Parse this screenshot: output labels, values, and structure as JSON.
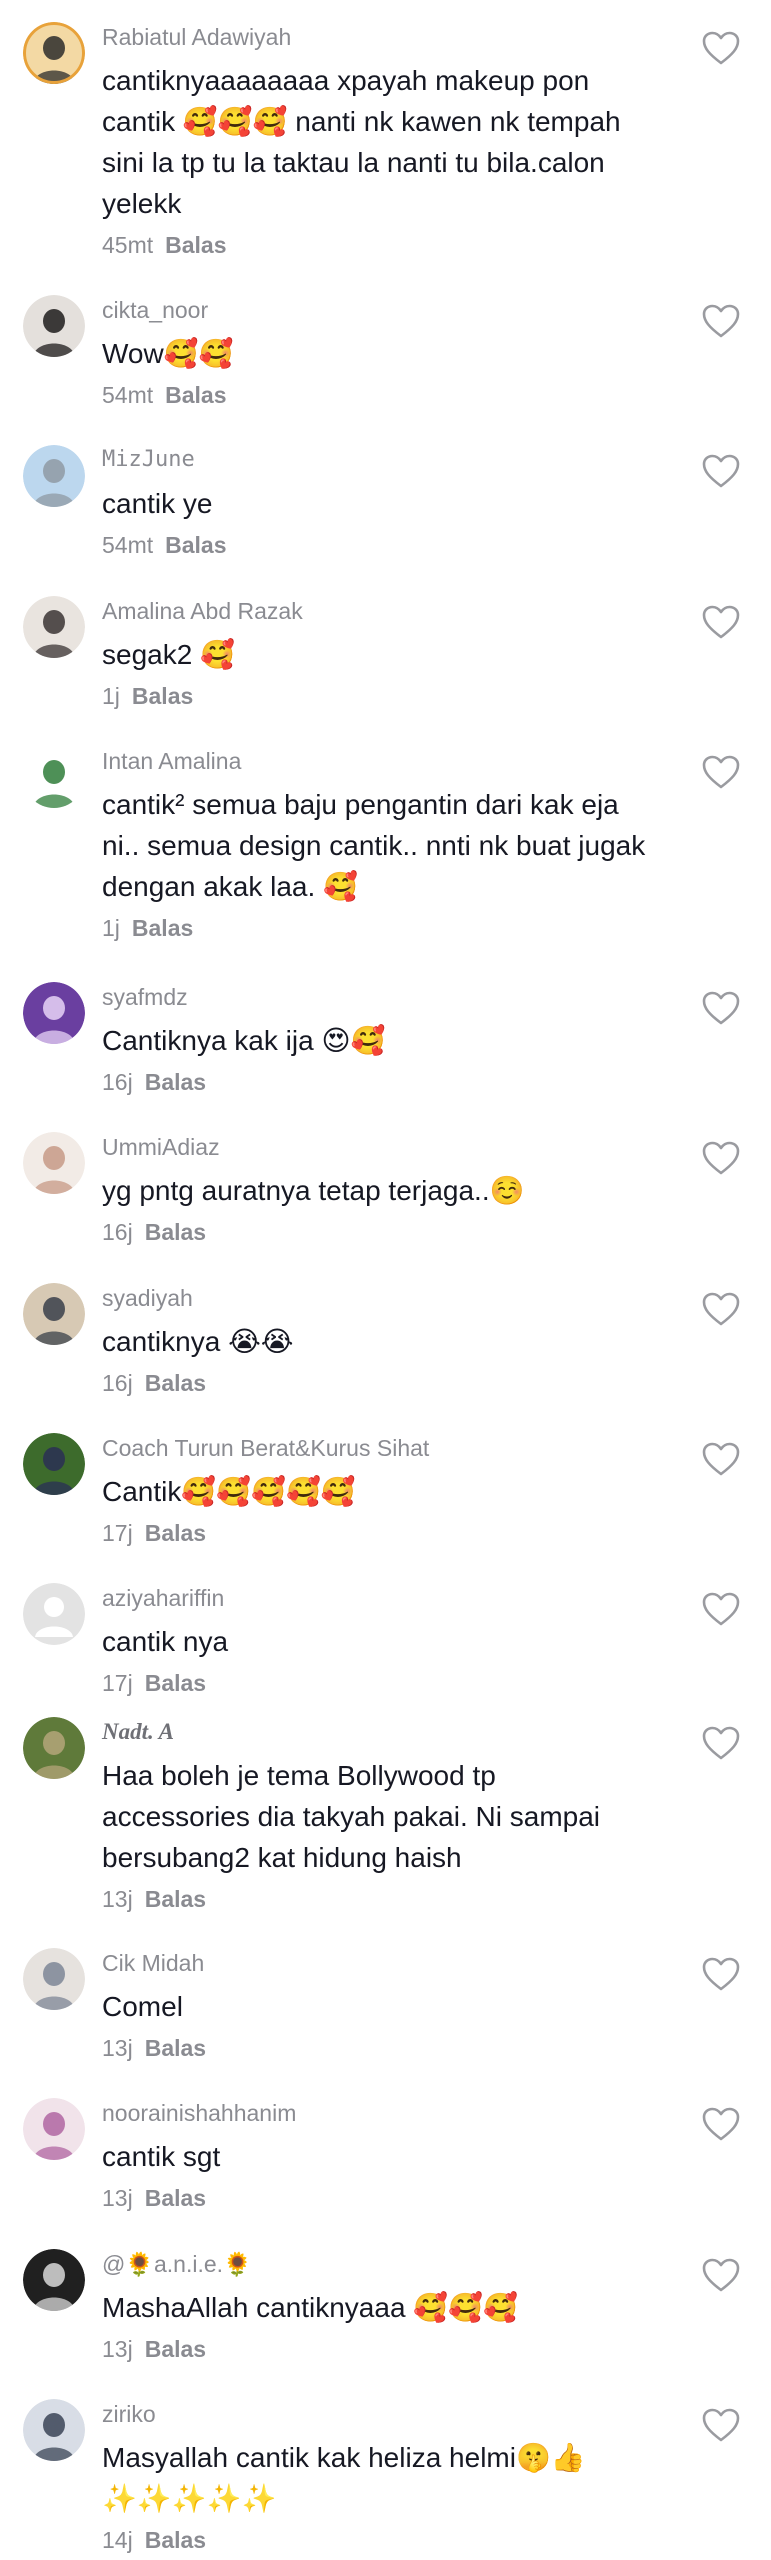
{
  "ui": {
    "reply_label": "Balas"
  },
  "comments": [
    {
      "username": "Rabiatul Adawiyah",
      "lines": [
        "cantiknyaaaaaaaa xpayah makeup pon",
        "cantik 🥰🥰🥰 nanti nk kawen nk tempah",
        "sini la tp tu la taktau la nanti tu bila.calon",
        "yelekk"
      ],
      "time": "45mt"
    },
    {
      "username": "cikta_noor",
      "lines": [
        "Wow🥰🥰"
      ],
      "time": "54mt"
    },
    {
      "username": "MizJune",
      "lines": [
        "cantik ye"
      ],
      "time": "54mt"
    },
    {
      "username": "Amalina Abd Razak",
      "lines": [
        "segak2 🥰"
      ],
      "time": "1j"
    },
    {
      "username": "Intan Amalina",
      "lines": [
        "cantik² semua baju pengantin dari kak eja",
        "ni.. semua design cantik.. nnti nk buat jugak",
        "dengan akak laa. 🥰"
      ],
      "time": "1j"
    },
    {
      "username": "syafmdz",
      "lines": [
        "Cantiknya kak ija 😍🥰"
      ],
      "time": "16j"
    },
    {
      "username": "UmmiAdiaz",
      "lines": [
        "yg pntg auratnya tetap terjaga..☺️"
      ],
      "time": "16j"
    },
    {
      "username": "syadiyah",
      "lines": [
        "cantiknya 😭😭"
      ],
      "time": "16j"
    },
    {
      "username": "Coach Turun Berat&Kurus Sihat",
      "lines": [
        "Cantik🥰🥰🥰🥰🥰"
      ],
      "time": "17j"
    },
    {
      "username": "aziyahariffin",
      "lines": [
        "cantik nya"
      ],
      "time": "17j"
    },
    {
      "username": "Nadt. A",
      "lines": [
        "Haa boleh je tema Bollywood tp",
        "accessories dia takyah pakai. Ni sampai",
        "bersubang2 kat hidung haish"
      ],
      "time": "13j"
    },
    {
      "username": "Cik Midah",
      "lines": [
        "Comel"
      ],
      "time": "13j"
    },
    {
      "username": "noorainishahhanim",
      "lines": [
        "cantik sgt"
      ],
      "time": "13j"
    },
    {
      "username": "@🌻a.n.i.e.🌻",
      "lines": [
        "MashaAllah cantiknyaaa 🥰🥰🥰"
      ],
      "time": "13j"
    },
    {
      "username": "ziriko",
      "lines": [
        "Masyallah cantik kak heliza helmi🤫👍",
        "✨✨✨✨✨"
      ],
      "time": "14j"
    }
  ],
  "avatars": [
    {
      "icon": "avatar-photo-icon",
      "bg": "#f3d9a4",
      "fg": "#2b2b2b",
      "ring": "#e8a23a"
    },
    {
      "icon": "avatar-photo-icon",
      "bg": "#e4e0dc",
      "fg": "#1d1b1b",
      "ring": ""
    },
    {
      "icon": "avatar-photo-icon",
      "bg": "#bcd7ee",
      "fg": "#8f9aa3",
      "ring": ""
    },
    {
      "icon": "avatar-photo-icon",
      "bg": "#e9e4df",
      "fg": "#3a3434",
      "ring": ""
    },
    {
      "icon": "avatar-photo-icon",
      "bg": "#ffffff",
      "fg": "#2f7d3a",
      "ring": ""
    },
    {
      "icon": "avatar-photo-icon",
      "bg": "#6a3fa0",
      "fg": "#e8d4f7",
      "ring": ""
    },
    {
      "icon": "avatar-photo-icon",
      "bg": "#f2ebe6",
      "fg": "#c79a86",
      "ring": ""
    },
    {
      "icon": "avatar-photo-icon",
      "bg": "#d7c9b4",
      "fg": "#39404a",
      "ring": ""
    },
    {
      "icon": "avatar-photo-icon",
      "bg": "#3d6b2c",
      "fg": "#2a2f55",
      "ring": ""
    },
    {
      "icon": "avatar-default-icon",
      "bg": "#e3e3e3",
      "fg": "#ffffff",
      "ring": ""
    },
    {
      "icon": "avatar-photo-icon",
      "bg": "#5f7a3a",
      "fg": "#b4a67a",
      "ring": ""
    },
    {
      "icon": "avatar-photo-icon",
      "bg": "#e6e2de",
      "fg": "#7d8696",
      "ring": ""
    },
    {
      "icon": "avatar-photo-icon",
      "bg": "#f1e3ea",
      "fg": "#b066a2",
      "ring": ""
    },
    {
      "icon": "avatar-photo-icon",
      "bg": "#202020",
      "fg": "#d9d9d9",
      "ring": ""
    },
    {
      "icon": "avatar-photo-icon",
      "bg": "#d8dde6",
      "fg": "#3b4456",
      "ring": ""
    }
  ],
  "icons": {
    "like": "heart-outline-icon"
  },
  "colors": {
    "username": "#8a8b91",
    "text": "#161823",
    "meta": "#8a8b91",
    "heart_stroke": "#9a9ba0"
  }
}
